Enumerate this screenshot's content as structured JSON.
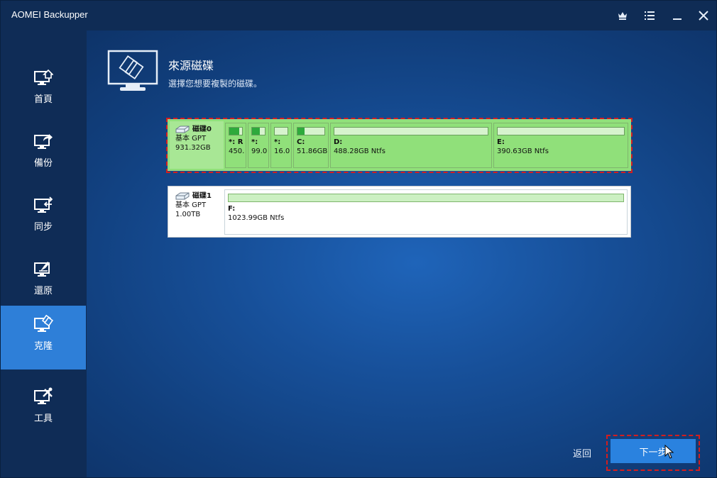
{
  "app": {
    "title": "AOMEI Backupper"
  },
  "titlebar": {
    "icons": [
      "crown-icon",
      "menu-icon",
      "minimize-icon",
      "close-icon"
    ]
  },
  "sidebar": {
    "items": [
      {
        "label": "首頁",
        "icon": "home-monitor-icon"
      },
      {
        "label": "備份",
        "icon": "backup-monitor-icon"
      },
      {
        "label": "同步",
        "icon": "sync-monitor-icon"
      },
      {
        "label": "還原",
        "icon": "restore-monitor-icon"
      },
      {
        "label": "克隆",
        "icon": "clone-monitor-icon",
        "active": true
      },
      {
        "label": "工具",
        "icon": "tools-monitor-icon"
      }
    ]
  },
  "header": {
    "title": "來源磁碟",
    "subtitle": "選擇您想要複製的磁碟。"
  },
  "disks": [
    {
      "name": "磁碟0",
      "type": "基本 GPT",
      "size": "931.32GB",
      "selected": true,
      "partitions": [
        {
          "letter": "*: R",
          "size": "450.",
          "used": 0.75
        },
        {
          "letter": "*:",
          "size": "99.0",
          "used": 0.6
        },
        {
          "letter": "*:",
          "size": "16.0",
          "used": 0.0
        },
        {
          "letter": "C:",
          "size": "51.86GB",
          "used": 0.25
        },
        {
          "letter": "D:",
          "size": "488.28GB Ntfs",
          "used": 0.0
        },
        {
          "letter": "E:",
          "size": "390.63GB Ntfs",
          "used": 0.0
        }
      ]
    },
    {
      "name": "磁碟1",
      "type": "基本 GPT",
      "size": "1.00TB",
      "selected": false,
      "partitions": [
        {
          "letter": "F:",
          "size": "1023.99GB Ntfs",
          "used": 0.0
        }
      ]
    }
  ],
  "footer": {
    "back_label": "返回",
    "next_label": "下一步"
  },
  "colors": {
    "accent": "#2a82df",
    "partition_green": "#90e07a",
    "used_fill": "#2eaa3c",
    "selection_dash": "#d41d1d"
  }
}
